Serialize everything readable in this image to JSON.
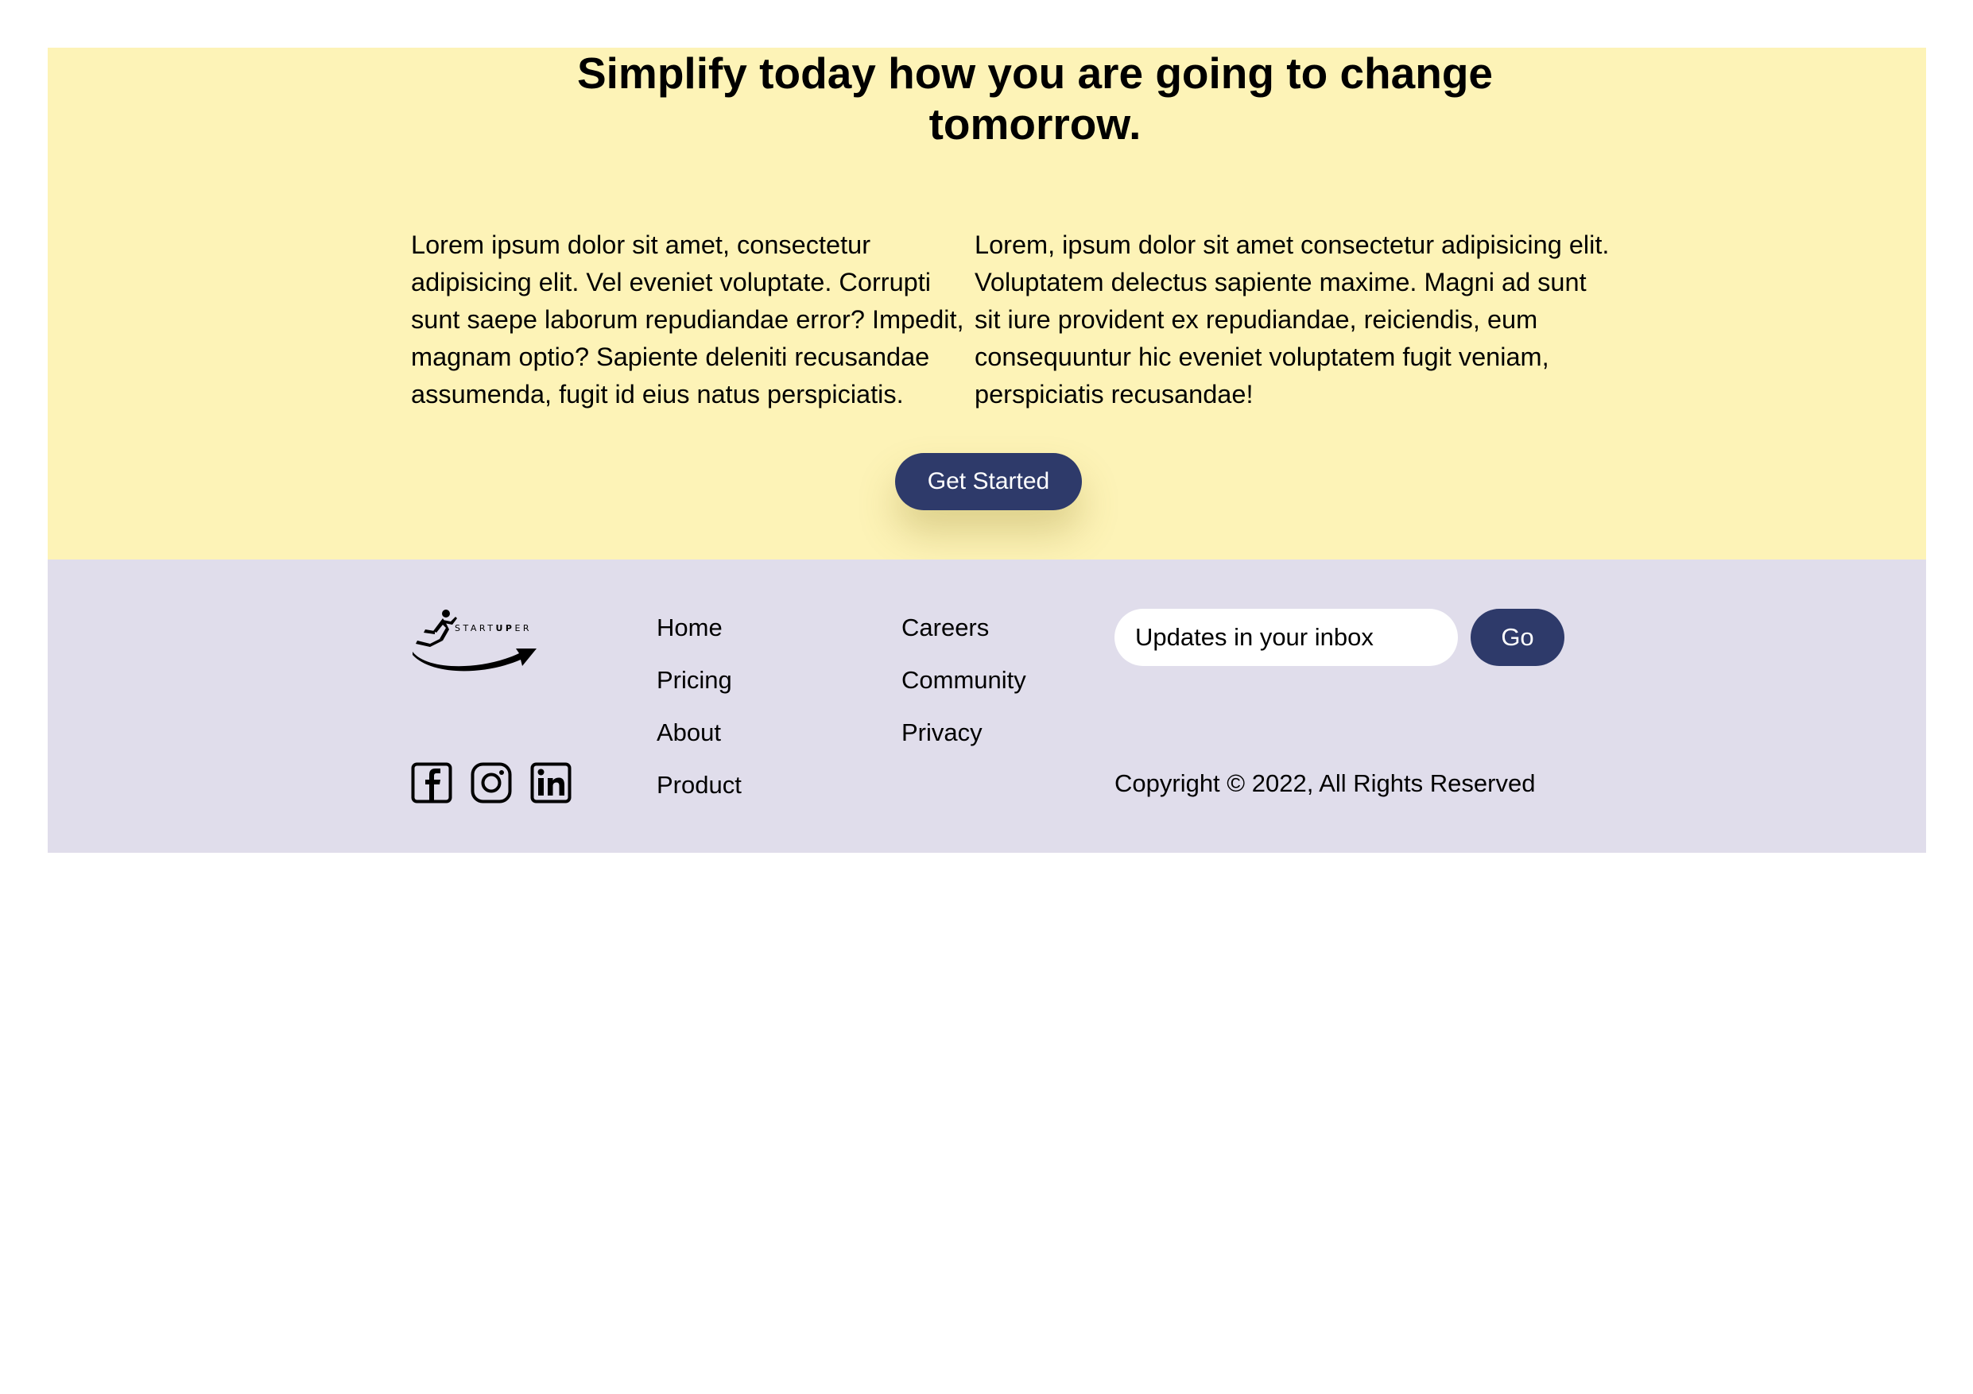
{
  "hero": {
    "title": "Simplify today how you are going to change tomorrow.",
    "paragraph_left": "Lorem ipsum dolor sit amet, consectetur adipisicing elit. Vel eveniet voluptate. Corrupti sunt saepe laborum repudiandae error? Impedit, magnam optio? Sapiente deleniti recusandae assumenda, fugit id eius natus perspiciatis.",
    "paragraph_right": "Lorem, ipsum dolor sit amet consectetur adipisicing elit. Voluptatem delectus sapiente maxime. Magni ad sunt sit iure provident ex repudiandae, reiciendis, eum consequuntur hic eveniet voluptatem fugit veniam, perspiciatis recusandae!",
    "cta_label": "Get Started"
  },
  "footer": {
    "logo": {
      "text_plain_1": "START",
      "text_bold": "UP",
      "text_plain_2": "ER",
      "icon": "runner-arrow-logo"
    },
    "social": [
      {
        "name": "facebook",
        "icon": "facebook-icon"
      },
      {
        "name": "instagram",
        "icon": "instagram-icon"
      },
      {
        "name": "linkedin",
        "icon": "linkedin-icon"
      }
    ],
    "nav_col1": [
      "Home",
      "Pricing",
      "About",
      "Product"
    ],
    "nav_col2": [
      "Careers",
      "Community",
      "Privacy"
    ],
    "newsletter": {
      "placeholder": "Updates in your inbox",
      "button_label": "Go"
    },
    "copyright": "Copyright © 2022, All Rights Reserved"
  },
  "colors": {
    "hero_bg": "#fdf3b7",
    "footer_bg": "#e0ddeb",
    "button_bg": "#2e3a6a",
    "button_text": "#ffffff"
  }
}
